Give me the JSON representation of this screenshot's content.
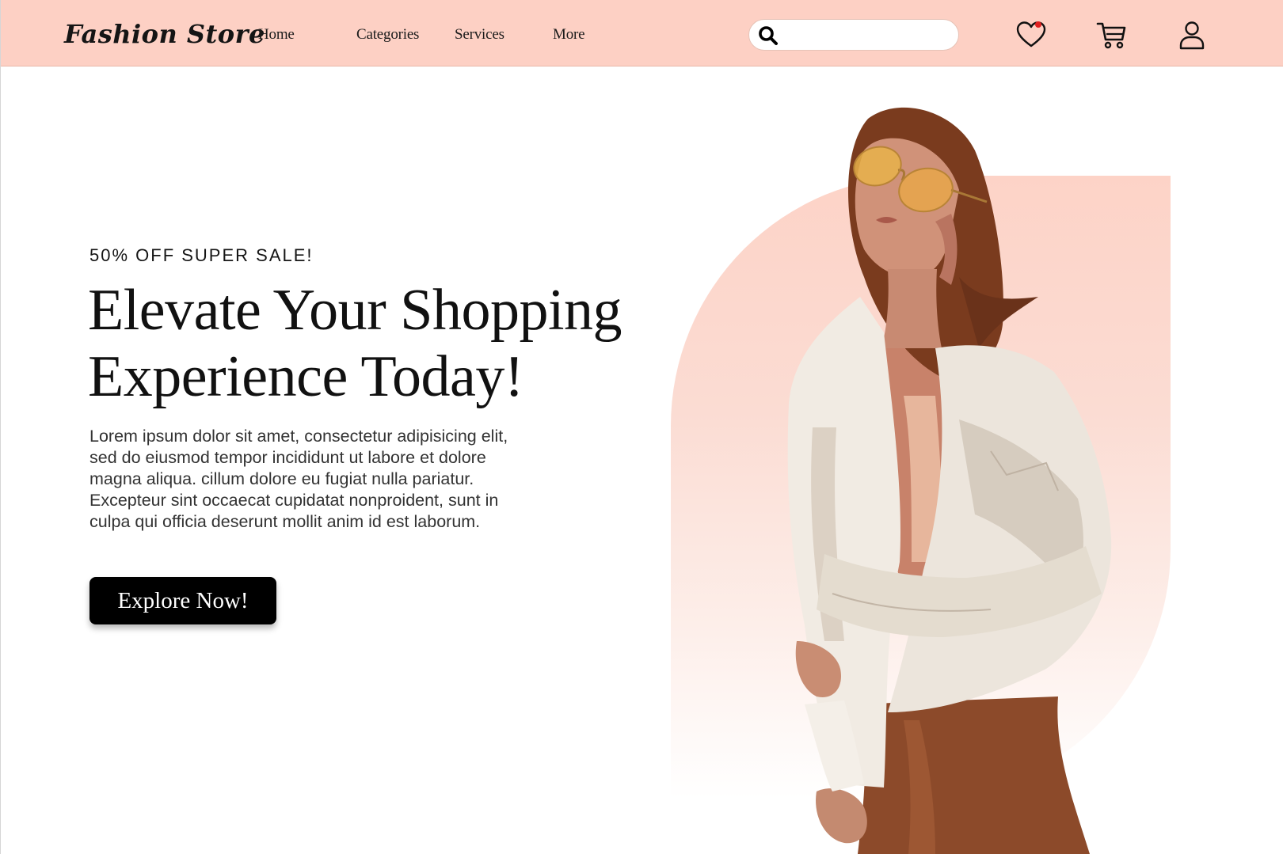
{
  "brand": {
    "name": "Fashion Store"
  },
  "nav": {
    "links": [
      "Home",
      "Categories",
      "Services",
      "More"
    ]
  },
  "search": {
    "placeholder": "",
    "value": ""
  },
  "icons": {
    "search": "search-icon",
    "wishlist": "heart-icon",
    "wishlist_badge_color": "#e02020",
    "cart": "cart-icon",
    "account": "user-icon"
  },
  "hero": {
    "promo": "50% OFF SUPER SALE!",
    "headline_line1": "Elevate Your Shopping",
    "headline_line2": "Experience Today!",
    "description": "Lorem ipsum dolor sit amet, consectetur adipisicing elit, sed do eiusmod tempor incididunt ut labore et dolore magna aliqua. cillum dolore eu fugiat nulla pariatur. Excepteur sint occaecat cupidatat nonproident, sunt in culpa qui officia deserunt mollit anim id est laborum.",
    "cta_label": "Explore Now!"
  },
  "colors": {
    "navbar_bg": "#fdd0c4",
    "accent_peach": "#fdd3c7",
    "button_bg": "#000000",
    "button_text": "#ffffff"
  }
}
